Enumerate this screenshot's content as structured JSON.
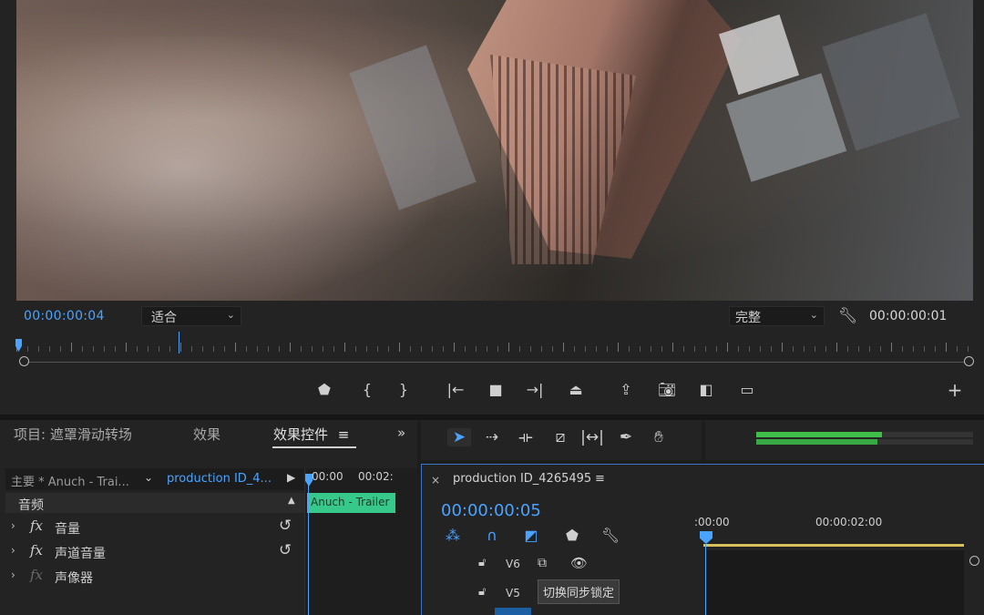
{
  "monitor": {
    "timecode_current": "00:00:00:04",
    "fit_select": "适合",
    "quality_select": "完整",
    "timecode_duration": "00:00:00:01"
  },
  "transport": {
    "icons": [
      "marker-icon",
      "mark-in-icon",
      "mark-out-icon",
      "go-to-in-icon",
      "stop-icon",
      "go-to-out-icon",
      "lift-icon",
      "extract-icon",
      "export-frame-icon",
      "compare-icon",
      "safe-margins-icon",
      "add-button-icon"
    ]
  },
  "left_panel": {
    "tab_project": "项目: 遮罩滑动转场",
    "tab_effects": "效果",
    "tab_effect_controls": "效果控件",
    "tab_menu": "≡",
    "tab_more": "»",
    "source_label": "主要 * Anuch - Trai...",
    "sequence_label": "production ID_4...",
    "audio_section": "音频",
    "effects": [
      {
        "name": "音量"
      },
      {
        "name": "声道音量"
      },
      {
        "name": "声像器"
      }
    ],
    "ec_time_start": "00:00",
    "ec_time_end": "00:02:",
    "clip_label": "Anuch - Trailer"
  },
  "timeline": {
    "sequence_name": "production ID_4265495",
    "menu": "≡",
    "timecode": "00:00:00:05",
    "ruler_start": ":00:00",
    "ruler_mark": "00:00:02:00",
    "tracks": [
      {
        "name": "V6"
      },
      {
        "name": "V5"
      }
    ],
    "tooltip": "切换同步锁定"
  },
  "meters": {
    "level_left": 0.58,
    "level_right": 0.56
  },
  "colors": {
    "accent_blue": "#4aa3ff",
    "clip_green": "#36c98a",
    "work_area": "#d8c15a"
  }
}
